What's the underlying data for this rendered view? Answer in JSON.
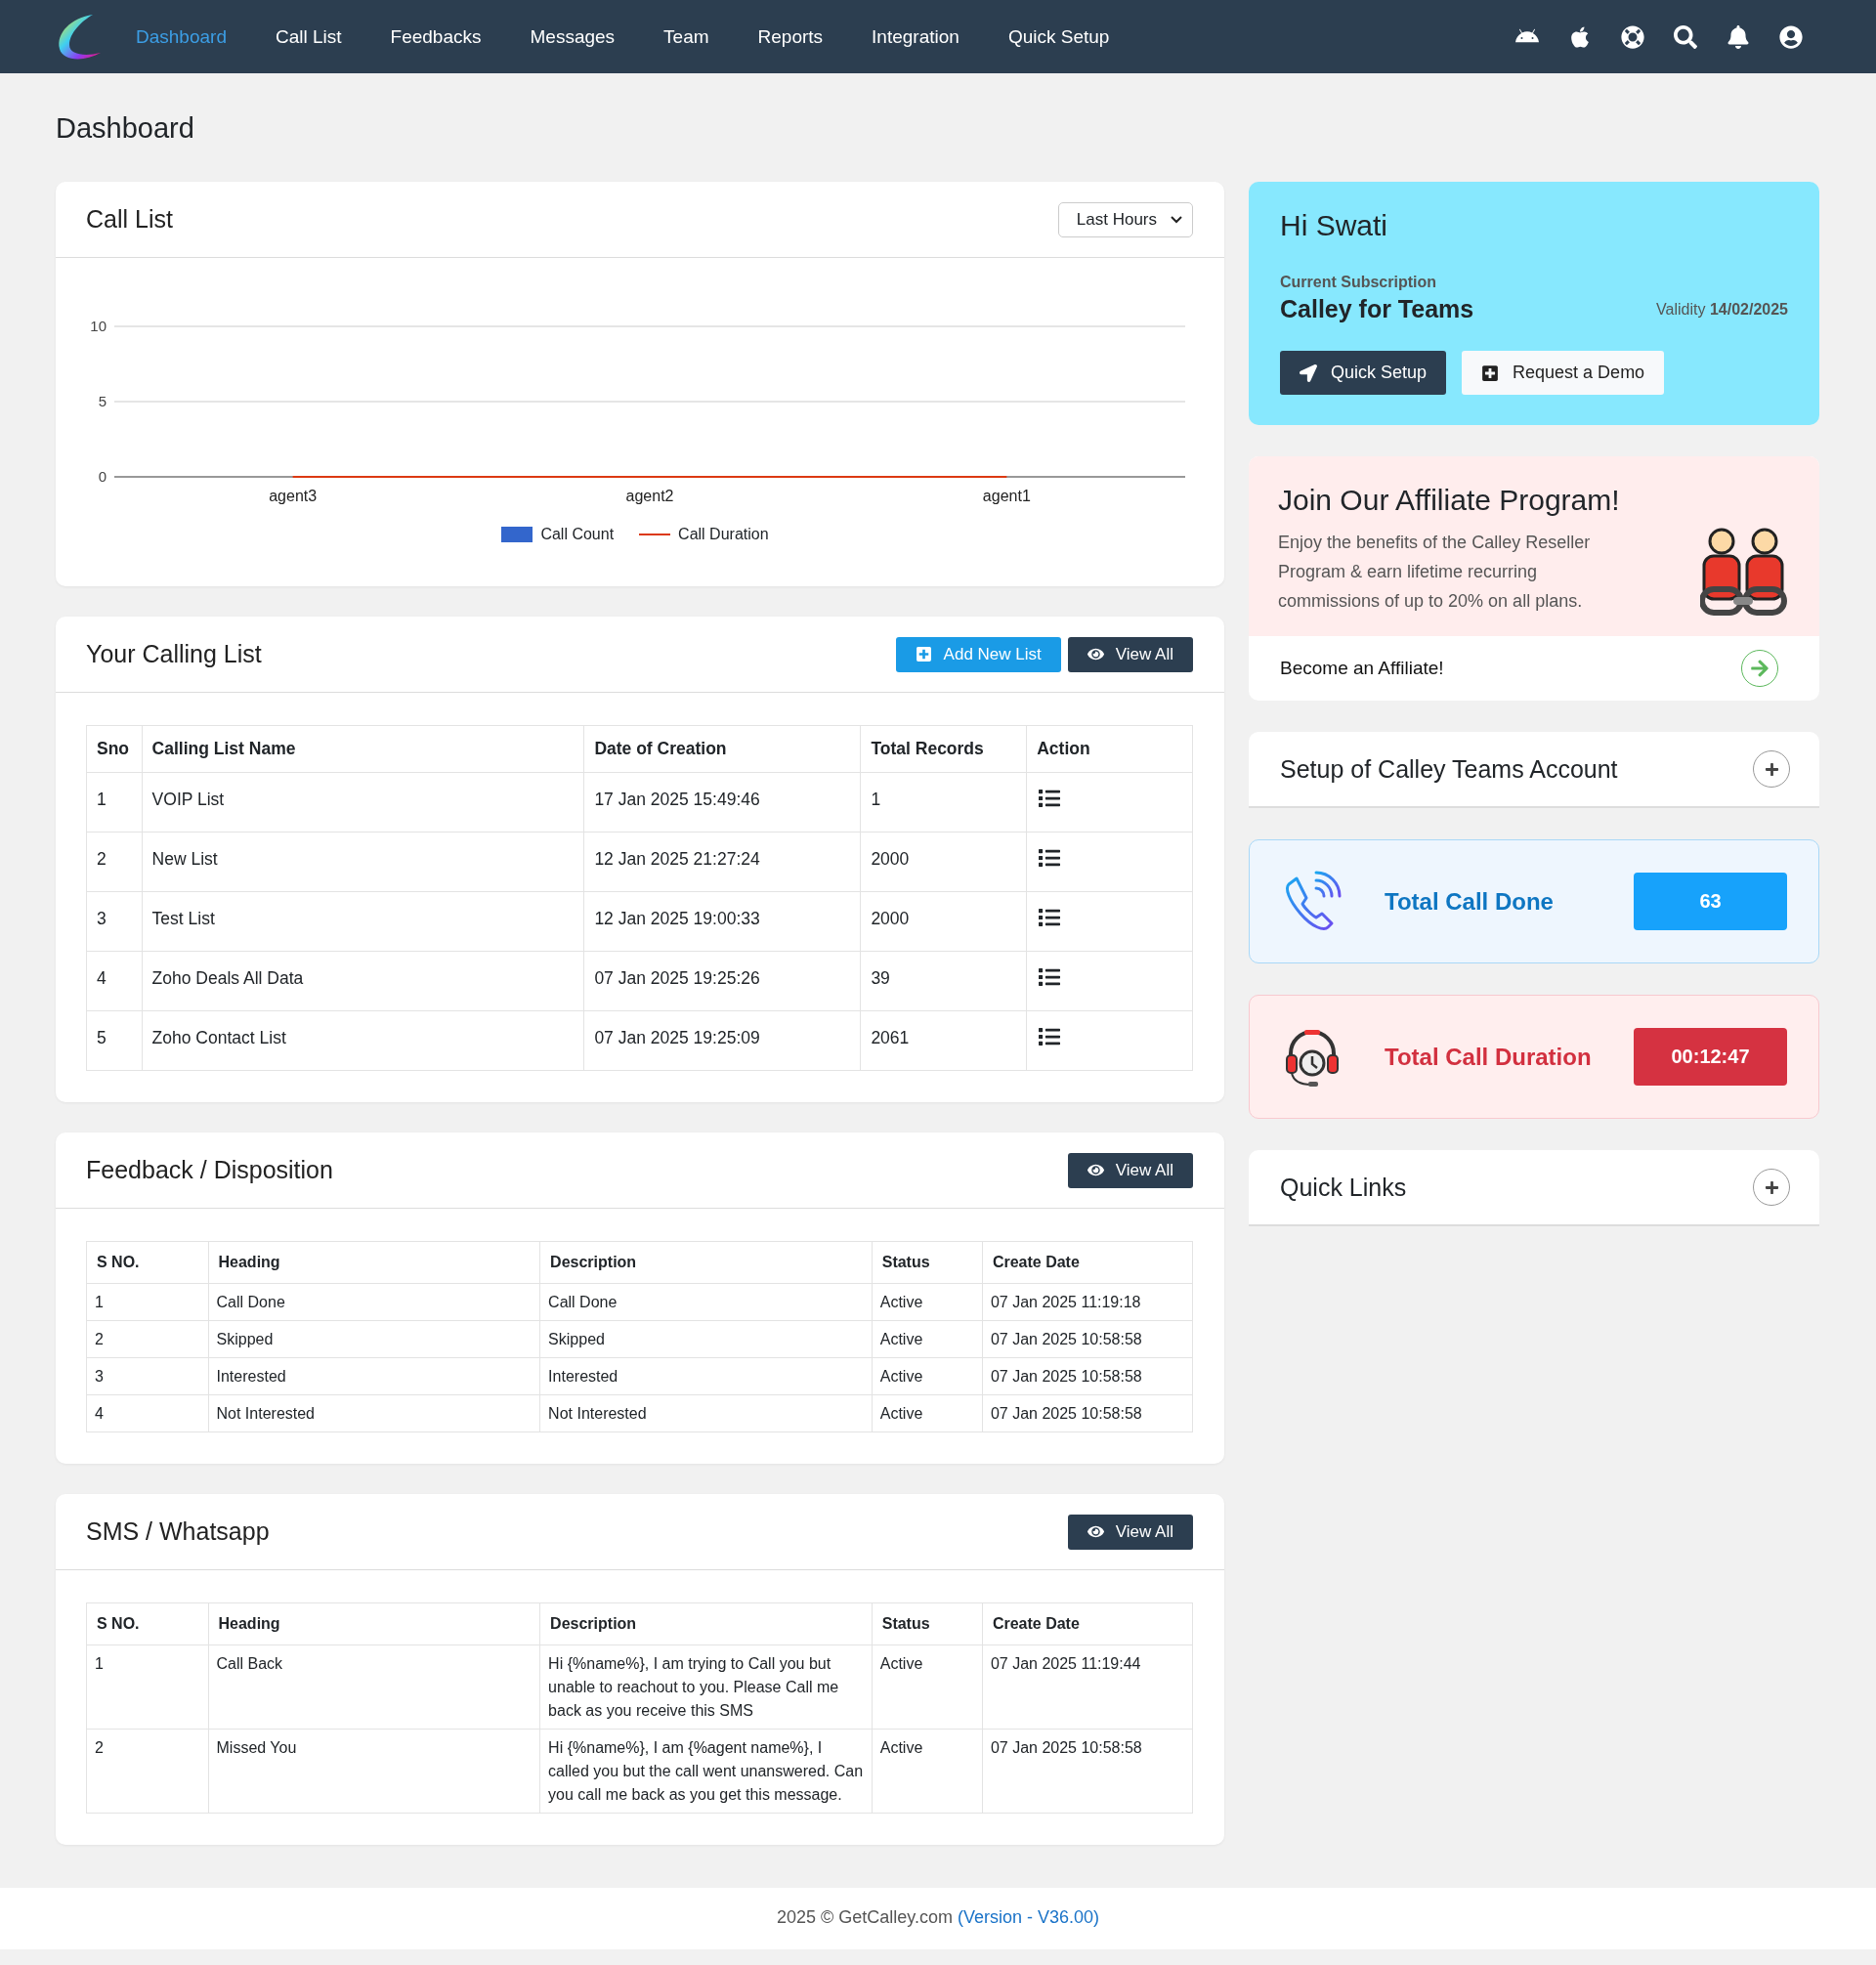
{
  "nav": {
    "items": [
      {
        "label": "Dashboard",
        "selected": true
      },
      {
        "label": "Call List",
        "selected": false
      },
      {
        "label": "Feedbacks",
        "selected": false
      },
      {
        "label": "Messages",
        "selected": false
      },
      {
        "label": "Team",
        "selected": false
      },
      {
        "label": "Reports",
        "selected": false
      },
      {
        "label": "Integration",
        "selected": false
      },
      {
        "label": "Quick Setup",
        "selected": false
      }
    ]
  },
  "page_title": "Dashboard",
  "call_list_card": {
    "title": "Call List",
    "period_select": {
      "value": "Last Hours"
    },
    "chart_data": {
      "type": "bar",
      "categories": [
        "agent3",
        "agent2",
        "agent1"
      ],
      "ylim": [
        0,
        10
      ],
      "yticks": [
        0,
        5,
        10
      ],
      "series": [
        {
          "name": "Call Count",
          "color": "#3366cc",
          "values": [
            0,
            0,
            0
          ]
        },
        {
          "name": "Call Duration",
          "color": "#dc3912",
          "values": [
            0,
            0,
            0
          ]
        }
      ]
    }
  },
  "calling_list": {
    "title": "Your Calling List",
    "buttons": [
      {
        "label": "Add New List",
        "kind": "add"
      },
      {
        "label": "View All",
        "kind": "view"
      }
    ],
    "columns": [
      "Sno",
      "Calling List Name",
      "Date of Creation",
      "Total Records",
      "Action"
    ],
    "rows": [
      [
        "1",
        "VOIP List",
        "17 Jan 2025 15:49:46",
        "1"
      ],
      [
        "2",
        "New List",
        "12 Jan 2025 21:27:24",
        "2000"
      ],
      [
        "3",
        "Test List",
        "12 Jan 2025 19:00:33",
        "2000"
      ],
      [
        "4",
        "Zoho Deals All Data",
        "07 Jan 2025 19:25:26",
        "39"
      ],
      [
        "5",
        "Zoho Contact List",
        "07 Jan 2025 19:25:09",
        "2061"
      ]
    ]
  },
  "feedback": {
    "title": "Feedback / Disposition",
    "buttons": [
      {
        "label": "View All",
        "kind": "view"
      }
    ],
    "columns": [
      "S NO.",
      "Heading",
      "Description",
      "Status",
      "Create Date"
    ],
    "rows": [
      [
        "1",
        "Call Done",
        "Call Done",
        "Active",
        "07 Jan 2025 11:19:18"
      ],
      [
        "2",
        "Skipped",
        "Skipped",
        "Active",
        "07 Jan 2025 10:58:58"
      ],
      [
        "3",
        "Interested",
        "Interested",
        "Active",
        "07 Jan 2025 10:58:58"
      ],
      [
        "4",
        "Not Interested",
        "Not Interested",
        "Active",
        "07 Jan 2025 10:58:58"
      ]
    ]
  },
  "sms": {
    "title": "SMS / Whatsapp",
    "buttons": [
      {
        "label": "View All",
        "kind": "view"
      }
    ],
    "columns": [
      "S NO.",
      "Heading",
      "Description",
      "Status",
      "Create Date"
    ],
    "rows": [
      [
        "1",
        "Call Back",
        "Hi {%name%}, I am trying to Call you but unable to reachout to you. Please Call me back as you receive this SMS",
        "Active",
        "07 Jan 2025 11:19:44"
      ],
      [
        "2",
        "Missed You",
        "Hi {%name%}, I am {%agent name%}, I called you but the call went unanswered. Can you call me back as you get this message.",
        "Active",
        "07 Jan 2025 10:58:58"
      ]
    ]
  },
  "greeting": {
    "title": "Hi Swati",
    "subscription_label": "Current Subscription",
    "plan": "Calley for Teams",
    "validity": "Validity **14/02/2025**",
    "buttons": [
      {
        "label": "Quick Setup",
        "kind": "primary"
      },
      {
        "label": "Request a Demo",
        "kind": "light"
      }
    ]
  },
  "affiliate": {
    "title": "Join Our Affiliate Program!",
    "text": "Enjoy the benefits of the Calley Reseller Program & earn lifetime recurring commissions of up to 20% on all plans.",
    "link": "Become an Affiliate!"
  },
  "setup_panel": {
    "title": "Setup of Calley Teams Account",
    "expanded": false
  },
  "stats": [
    {
      "kind": "calls",
      "label": "Total Call Done",
      "value": "63"
    },
    {
      "kind": "duration",
      "label": "Total Call Duration",
      "value": "00:12:47"
    }
  ],
  "quick_links": {
    "title": "Quick Links",
    "expanded": false
  },
  "footer": {
    "text": "2025 © GetCalley.com",
    "version": "(Version - V36.00)"
  }
}
